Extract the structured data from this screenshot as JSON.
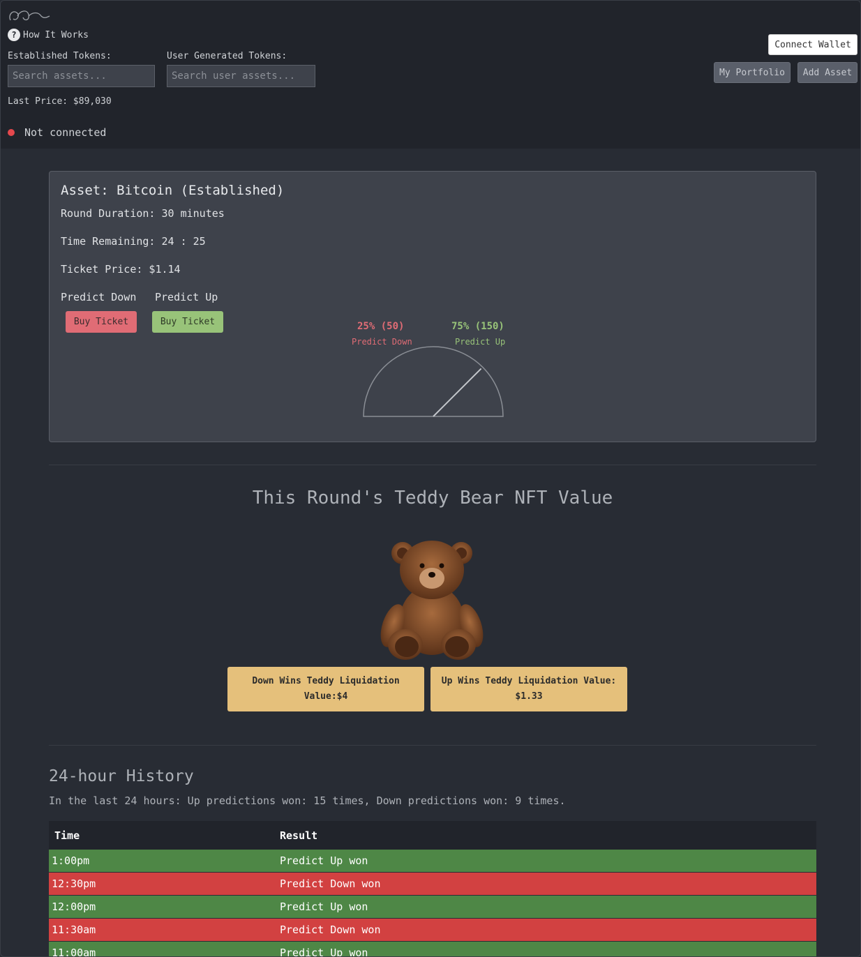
{
  "header": {
    "how_it_works": "How It Works",
    "established_label": "Established Tokens:",
    "established_placeholder": "Search assets...",
    "user_label": "User Generated Tokens:",
    "user_placeholder": "Search user assets...",
    "last_price": "Last Price: $89,030",
    "connection_status": "Not connected",
    "connect_wallet": "Connect Wallet",
    "my_portfolio": "My Portfolio",
    "add_asset": "Add Asset"
  },
  "round": {
    "asset": "Asset: Bitcoin (Established)",
    "duration": "Round Duration: 30 minutes",
    "time_remaining": "Time Remaining: 24 : 25",
    "ticket_price": "Ticket Price: $1.14",
    "predict_down_label": "Predict Down",
    "predict_up_label": "Predict Up",
    "buy_down": "Buy Ticket",
    "buy_up": "Buy Ticket",
    "gauge": {
      "down_pct": "25% (50)",
      "down_label": "Predict Down",
      "up_pct": "75% (150)",
      "up_label": "Predict Up",
      "up_fraction": 0.75,
      "down_color": "#e06c75",
      "up_color": "#98c379"
    }
  },
  "nft": {
    "title": "This Round's Teddy Bear NFT Value",
    "down_wins": "Down Wins Teddy Liquidation Value:$4",
    "up_wins": "Up Wins Teddy Liquidation Value: $1.33"
  },
  "history": {
    "title": "24-hour History",
    "summary": "In the last 24 hours: Up predictions won: 15 times, Down predictions won: 9 times.",
    "columns": [
      "Time",
      "Result"
    ],
    "rows": [
      {
        "time": "1:00pm",
        "result": "Predict Up won",
        "kind": "up"
      },
      {
        "time": "12:30pm",
        "result": "Predict Down won",
        "kind": "down"
      },
      {
        "time": "12:00pm",
        "result": "Predict Up won",
        "kind": "up"
      },
      {
        "time": "11:30am",
        "result": "Predict Down won",
        "kind": "down"
      },
      {
        "time": "11:00am",
        "result": "Predict Up won",
        "kind": "up"
      }
    ]
  }
}
